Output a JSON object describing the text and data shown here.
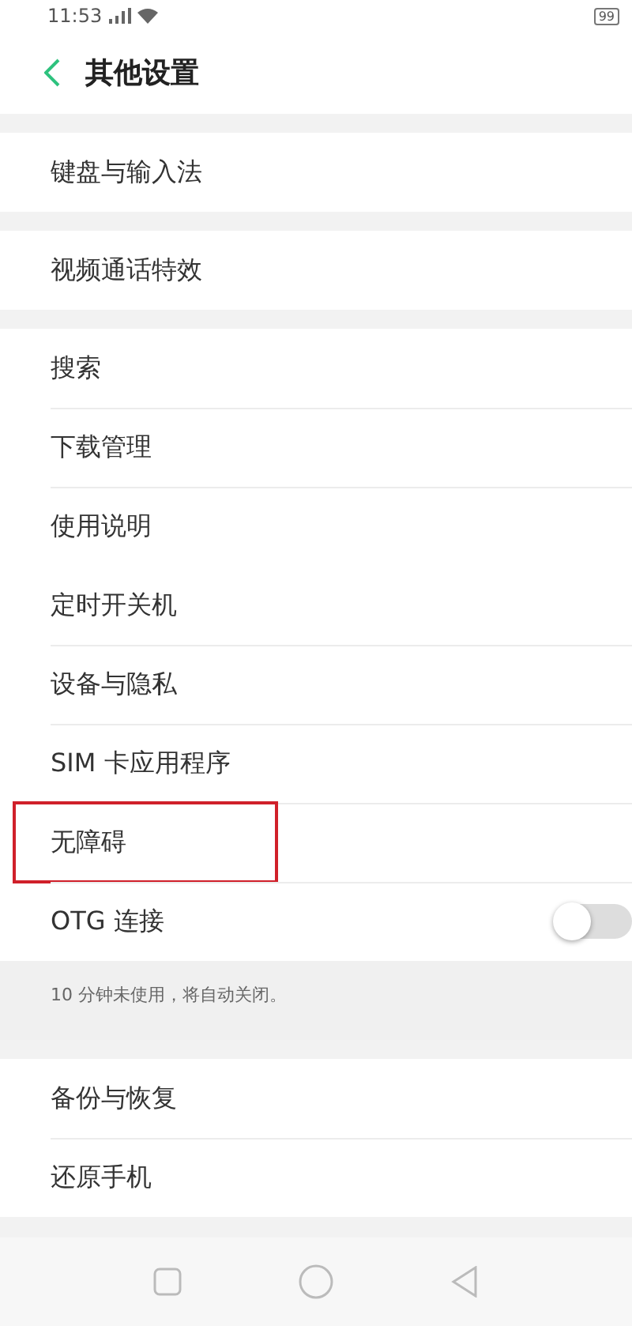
{
  "status_bar": {
    "time": "11:53",
    "battery": "99"
  },
  "header": {
    "title": "其他设置"
  },
  "groups": [
    {
      "items": [
        {
          "kind": "link",
          "label": "键盘与输入法",
          "highlighted": false
        }
      ]
    },
    {
      "items": [
        {
          "kind": "link",
          "label": "视频通话特效",
          "highlighted": false
        }
      ]
    },
    {
      "items": [
        {
          "kind": "link",
          "label": "搜索",
          "highlighted": false
        },
        {
          "kind": "link",
          "label": "下载管理",
          "highlighted": false
        },
        {
          "kind": "link",
          "label": "使用说明",
          "highlighted": false
        }
      ]
    },
    {
      "items": [
        {
          "kind": "link",
          "label": "定时开关机",
          "highlighted": false
        },
        {
          "kind": "link",
          "label": "设备与隐私",
          "highlighted": false
        },
        {
          "kind": "link",
          "label": "SIM 卡应用程序",
          "highlighted": false
        },
        {
          "kind": "link",
          "label": "无障碍",
          "highlighted": true
        },
        {
          "kind": "toggle",
          "label": "OTG 连接",
          "on": false,
          "highlighted": false
        }
      ],
      "note": "10 分钟未使用，将自动关闭。"
    },
    {
      "items": [
        {
          "kind": "link",
          "label": "备份与恢复",
          "highlighted": false
        },
        {
          "kind": "link",
          "label": "还原手机",
          "highlighted": false
        }
      ]
    }
  ]
}
